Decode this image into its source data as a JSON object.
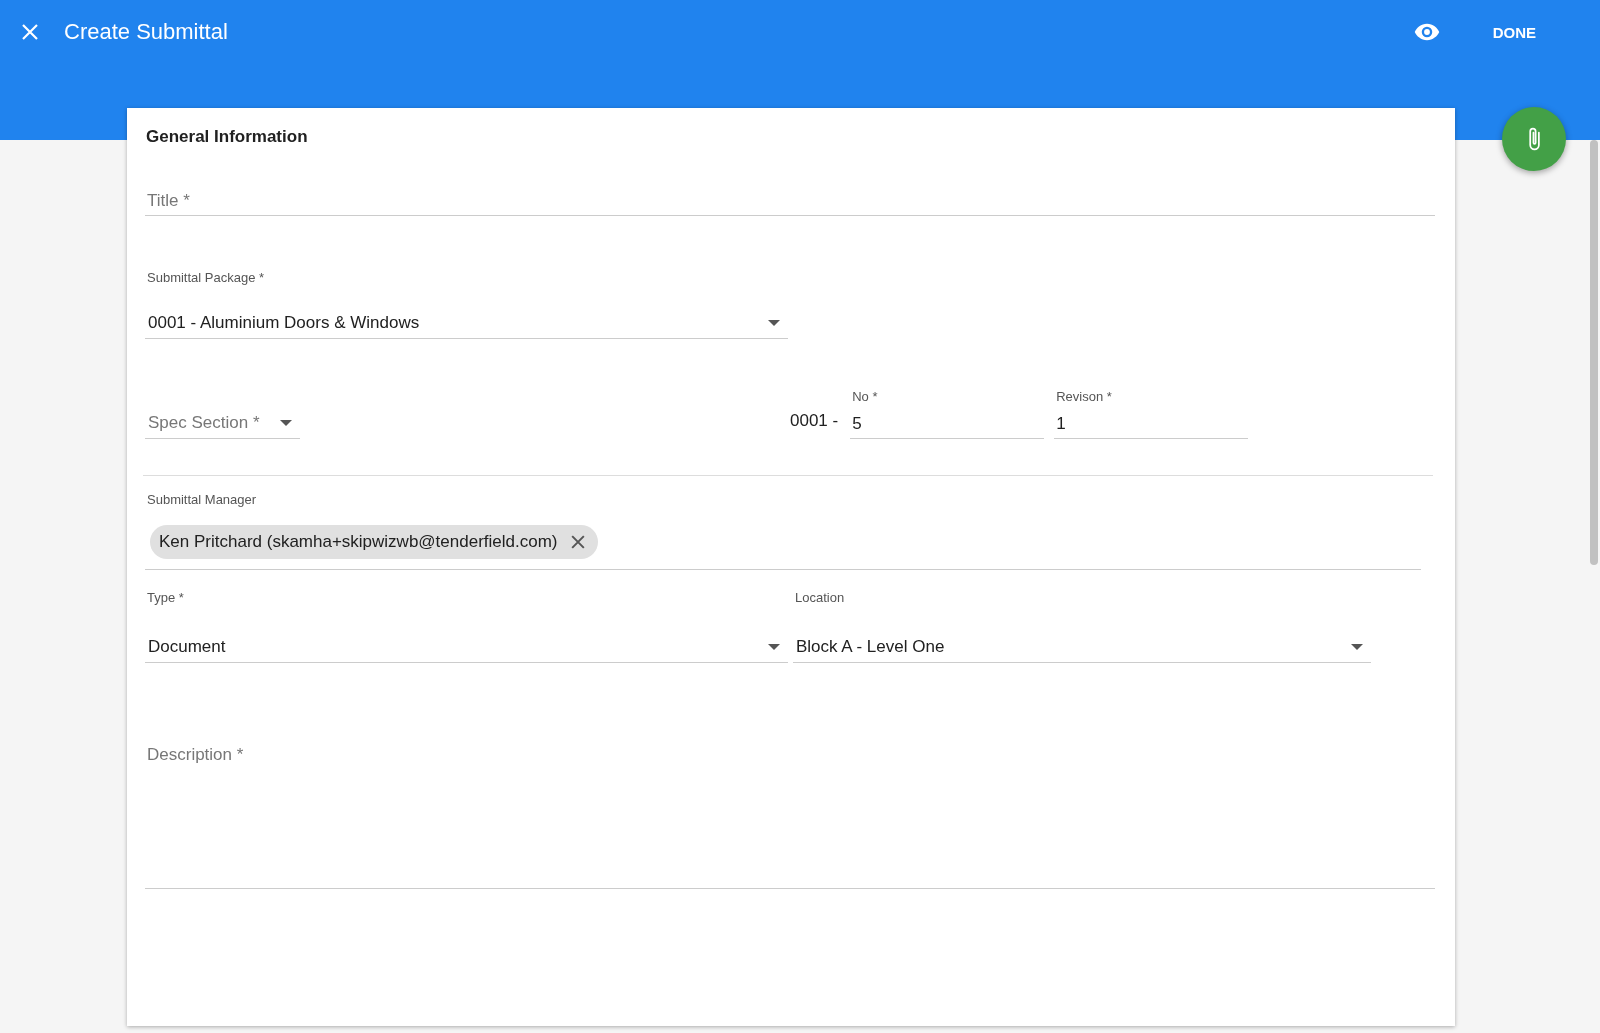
{
  "header": {
    "title": "Create Submittal",
    "done_button": "DONE"
  },
  "card": {
    "heading": "General Information",
    "title_field": {
      "placeholder": "Title *"
    },
    "submittal_package": {
      "label": "Submittal Package *",
      "value": "0001 - Aluminium Doors & Windows"
    },
    "spec_section": {
      "placeholder": "Spec Section *"
    },
    "number_prefix": "0001 -",
    "no_field": {
      "label": "No *",
      "value": "5"
    },
    "revision_field": {
      "label": "Revison *",
      "value": "1"
    },
    "submittal_manager": {
      "label": "Submittal Manager",
      "chips": [
        "Ken Pritchard (skamha+skipwizwb@tenderfield.com)"
      ]
    },
    "type": {
      "label": "Type *",
      "value": "Document"
    },
    "location": {
      "label": "Location",
      "value": "Block A - Level One"
    },
    "description": {
      "placeholder": "Description *"
    }
  }
}
